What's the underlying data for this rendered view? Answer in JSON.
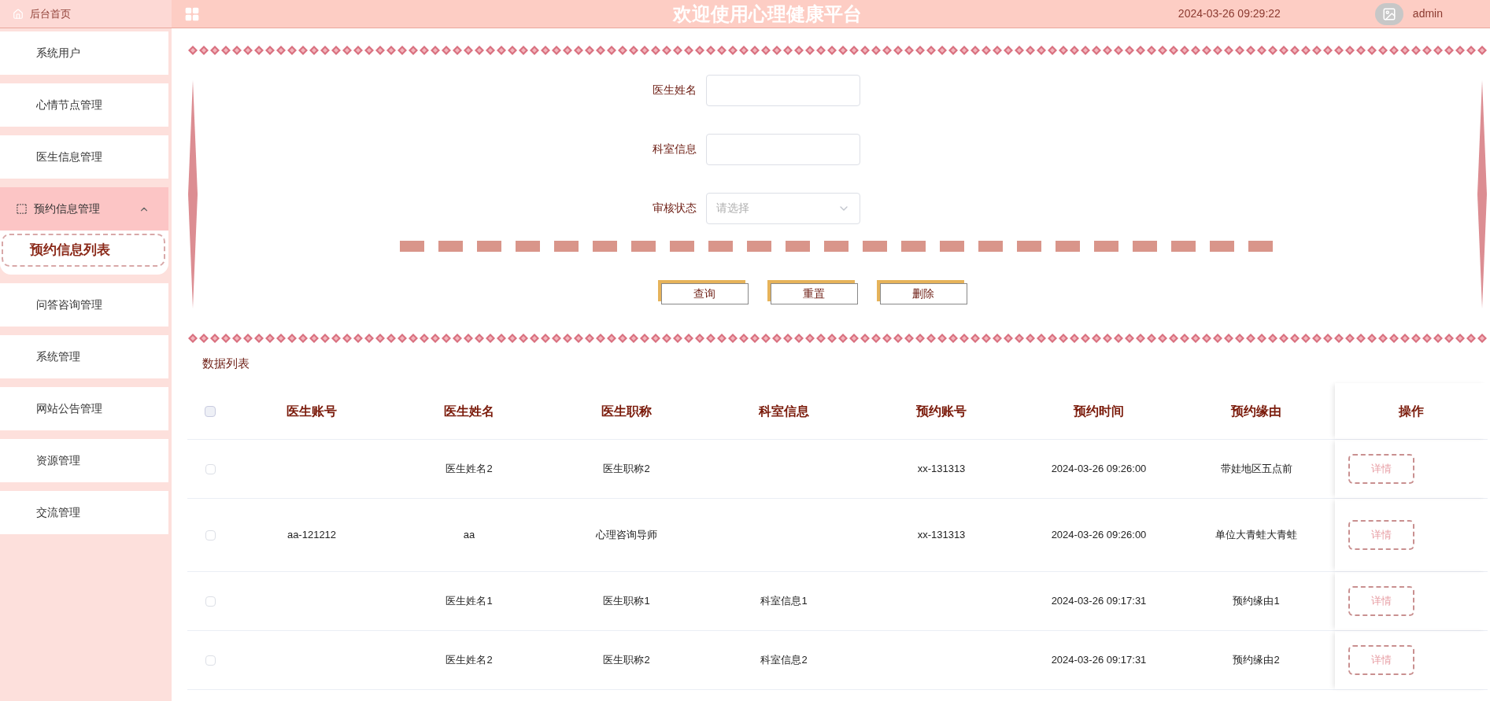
{
  "header": {
    "home_label": "后台首页",
    "title": "欢迎使用心理健康平台",
    "datetime": "2024-03-26 09:29:22",
    "user": "admin"
  },
  "sidebar": {
    "items": [
      {
        "label": "系统用户",
        "selected": false
      },
      {
        "label": "心情节点管理",
        "selected": false
      },
      {
        "label": "医生信息管理",
        "selected": false
      },
      {
        "label": "预约信息管理",
        "selected": true,
        "expanded": true,
        "children": [
          {
            "label": "预约信息列表",
            "selected": true
          }
        ]
      },
      {
        "label": "问答咨询管理",
        "selected": false
      },
      {
        "label": "系统管理",
        "selected": false
      },
      {
        "label": "网站公告管理",
        "selected": false
      },
      {
        "label": "资源管理",
        "selected": false
      },
      {
        "label": "交流管理",
        "selected": false
      }
    ]
  },
  "search_form": {
    "fields": [
      {
        "label": "医生姓名",
        "kind": "text"
      },
      {
        "label": "科室信息",
        "kind": "text"
      },
      {
        "label": "审核状态",
        "kind": "select",
        "placeholder": "请选择"
      }
    ],
    "buttons": [
      "查询",
      "重置",
      "删除"
    ]
  },
  "table": {
    "title": "数据列表",
    "all_checked": false,
    "columns": [
      "医生账号",
      "医生姓名",
      "医生职称",
      "科室信息",
      "预约账号",
      "预约时间",
      "预约缘由",
      "操作"
    ],
    "rows": [
      {
        "checked": false,
        "cells": [
          "",
          "医生姓名2",
          "医生职称2",
          "",
          "xx-131313",
          "2024-03-26 09:26:00",
          "带娃地区五点前"
        ],
        "action": "详情"
      },
      {
        "checked": false,
        "cells": [
          "aa-121212",
          "aa",
          "心理咨询导师",
          "",
          "xx-131313",
          "2024-03-26 09:26:00",
          "单位大青蛙大青蛙"
        ],
        "action": "详情"
      },
      {
        "checked": false,
        "cells": [
          "",
          "医生姓名1",
          "医生职称1",
          "科室信息1",
          "",
          "2024-03-26 09:17:31",
          "预约缘由1"
        ],
        "action": "详情"
      },
      {
        "checked": false,
        "cells": [
          "",
          "医生姓名2",
          "医生职称2",
          "科室信息2",
          "",
          "2024-03-26 09:17:31",
          "预约缘由2"
        ],
        "action": "详情"
      }
    ]
  }
}
